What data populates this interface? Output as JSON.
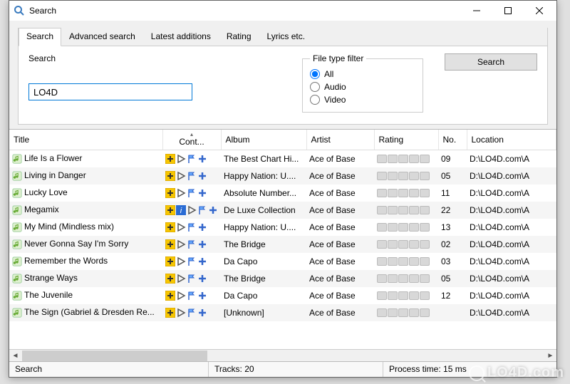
{
  "window": {
    "title": "Search"
  },
  "tabs": [
    {
      "label": "Search",
      "active": true
    },
    {
      "label": "Advanced search"
    },
    {
      "label": "Latest additions"
    },
    {
      "label": "Rating"
    },
    {
      "label": "Lyrics etc."
    }
  ],
  "search": {
    "label": "Search",
    "value": "LO4D",
    "button": "Search"
  },
  "file_filter": {
    "legend": "File type filter",
    "options": [
      {
        "label": "All",
        "checked": true
      },
      {
        "label": "Audio",
        "checked": false
      },
      {
        "label": "Video",
        "checked": false
      }
    ]
  },
  "columns": {
    "title": "Title",
    "cont": "Cont...",
    "album": "Album",
    "artist": "Artist",
    "rating": "Rating",
    "no": "No.",
    "location": "Location"
  },
  "rows": [
    {
      "title": "Life Is a Flower",
      "album": "The Best Chart Hi...",
      "artist": "Ace of Base",
      "no": "09",
      "location": "D:\\LO4D.com\\A",
      "info": false
    },
    {
      "title": "Living in Danger",
      "album": "Happy Nation: U....",
      "artist": "Ace of Base",
      "no": "05",
      "location": "D:\\LO4D.com\\A",
      "info": false
    },
    {
      "title": "Lucky Love",
      "album": "Absolute Number...",
      "artist": "Ace of Base",
      "no": "11",
      "location": "D:\\LO4D.com\\A",
      "info": false
    },
    {
      "title": "Megamix",
      "album": "De Luxe Collection",
      "artist": "Ace of Base",
      "no": "22",
      "location": "D:\\LO4D.com\\A",
      "info": true
    },
    {
      "title": "My Mind (Mindless mix)",
      "album": "Happy Nation: U....",
      "artist": "Ace of Base",
      "no": "13",
      "location": "D:\\LO4D.com\\A",
      "info": false
    },
    {
      "title": "Never Gonna Say I'm Sorry",
      "album": "The Bridge",
      "artist": "Ace of Base",
      "no": "02",
      "location": "D:\\LO4D.com\\A",
      "info": false
    },
    {
      "title": "Remember the Words",
      "album": "Da Capo",
      "artist": "Ace of Base",
      "no": "03",
      "location": "D:\\LO4D.com\\A",
      "info": false
    },
    {
      "title": "Strange Ways",
      "album": "The Bridge",
      "artist": "Ace of Base",
      "no": "05",
      "location": "D:\\LO4D.com\\A",
      "info": false
    },
    {
      "title": "The Juvenile",
      "album": "Da Capo",
      "artist": "Ace of Base",
      "no": "12",
      "location": "D:\\LO4D.com\\A",
      "info": false
    },
    {
      "title": "The Sign (Gabriel & Dresden Re...",
      "album": "[Unknown]",
      "artist": "Ace of Base",
      "no": "",
      "location": "D:\\LO4D.com\\A",
      "info": false
    }
  ],
  "status": {
    "left": "Search",
    "tracks_label": "Tracks:",
    "tracks_value": "20",
    "process_label": "Process time:",
    "process_value": "15 ms"
  },
  "watermark": "LO4D.com"
}
